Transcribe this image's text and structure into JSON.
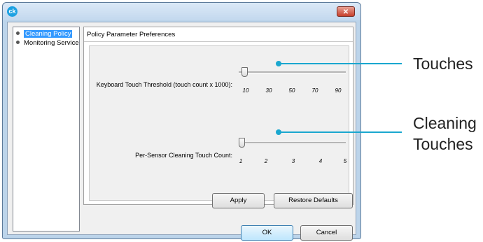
{
  "window": {
    "app_icon": "ck",
    "close_icon": "✕"
  },
  "nav": {
    "items": [
      {
        "label": "Cleaning Policy",
        "selected": true
      },
      {
        "label": "Monitoring Service",
        "selected": false
      }
    ]
  },
  "panel": {
    "title": "Policy Parameter Preferences",
    "sliders": [
      {
        "label": "Keyboard Touch Threshold (touch count x 1000):",
        "ticks": [
          "10",
          "30",
          "50",
          "70",
          "90"
        ],
        "value_fraction": 0.03
      },
      {
        "label": "Per-Sensor Cleaning Touch Count:",
        "ticks": [
          "1",
          "2",
          "3",
          "4",
          "5"
        ],
        "value_fraction": 0.0
      }
    ],
    "buttons": {
      "apply": "Apply",
      "restore_defaults": "Restore Defaults"
    }
  },
  "footer": {
    "ok": "OK",
    "cancel": "Cancel"
  },
  "callouts": {
    "touches": "Touches",
    "cleaning_touches_line1": "Cleaning",
    "cleaning_touches_line2": "Touches",
    "color": "#1aa7cf"
  }
}
